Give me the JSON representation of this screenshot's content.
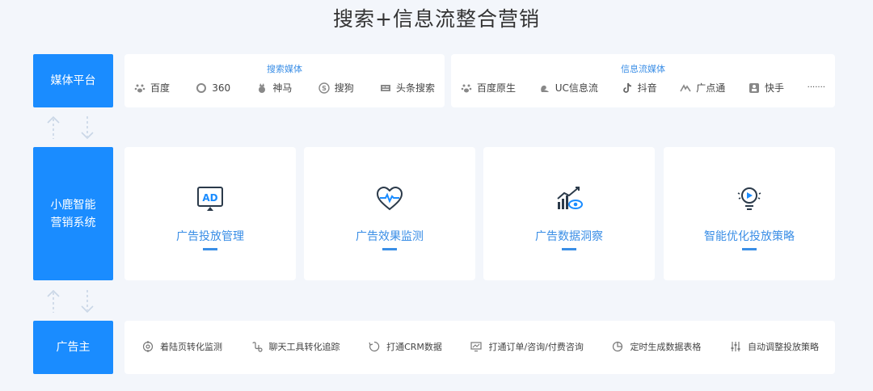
{
  "title": "搜索+信息流整合营销",
  "colors": {
    "accent": "#1a8cff",
    "link": "#3a8ee6",
    "background": "#f3f6fb"
  },
  "left_labels": {
    "media": "媒体平台",
    "system_line1": "小鹿智能",
    "system_line2": "营销系统",
    "advertiser": "广告主"
  },
  "search_media": {
    "heading": "搜索媒体",
    "items": [
      {
        "label": "百度",
        "icon": "paw-icon"
      },
      {
        "label": "360",
        "icon": "ring-icon"
      },
      {
        "label": "神马",
        "icon": "horse-icon"
      },
      {
        "label": "搜狗",
        "icon": "sogou-icon"
      },
      {
        "label": "头条搜索",
        "icon": "toutiao-icon"
      }
    ]
  },
  "feed_media": {
    "heading": "信息流媒体",
    "items": [
      {
        "label": "百度原生",
        "icon": "paw-icon"
      },
      {
        "label": "UC信息流",
        "icon": "squirrel-icon"
      },
      {
        "label": "抖音",
        "icon": "tiktok-icon"
      },
      {
        "label": "广点通",
        "icon": "gdt-icon"
      },
      {
        "label": "快手",
        "icon": "kuaishou-icon"
      },
      {
        "label": "·······",
        "icon": ""
      }
    ]
  },
  "system_cards": [
    {
      "label": "广告投放管理",
      "icon": "ad-screen-icon"
    },
    {
      "label": "广告效果监测",
      "icon": "heart-pulse-icon"
    },
    {
      "label": "广告数据洞察",
      "icon": "chart-eye-icon"
    },
    {
      "label": "智能优化投放策略",
      "icon": "bulb-play-icon"
    }
  ],
  "advertiser_items": [
    {
      "label": "着陆页转化监测",
      "icon": "target-icon"
    },
    {
      "label": "聊天工具转化追踪",
      "icon": "chat-icon"
    },
    {
      "label": "打通CRM数据",
      "icon": "cycle-icon"
    },
    {
      "label": "打通订单/咨询/付费咨询",
      "icon": "monitor-icon"
    },
    {
      "label": "定时生成数据表格",
      "icon": "pie-icon"
    },
    {
      "label": "自动调整投放策略",
      "icon": "sliders-icon"
    }
  ]
}
